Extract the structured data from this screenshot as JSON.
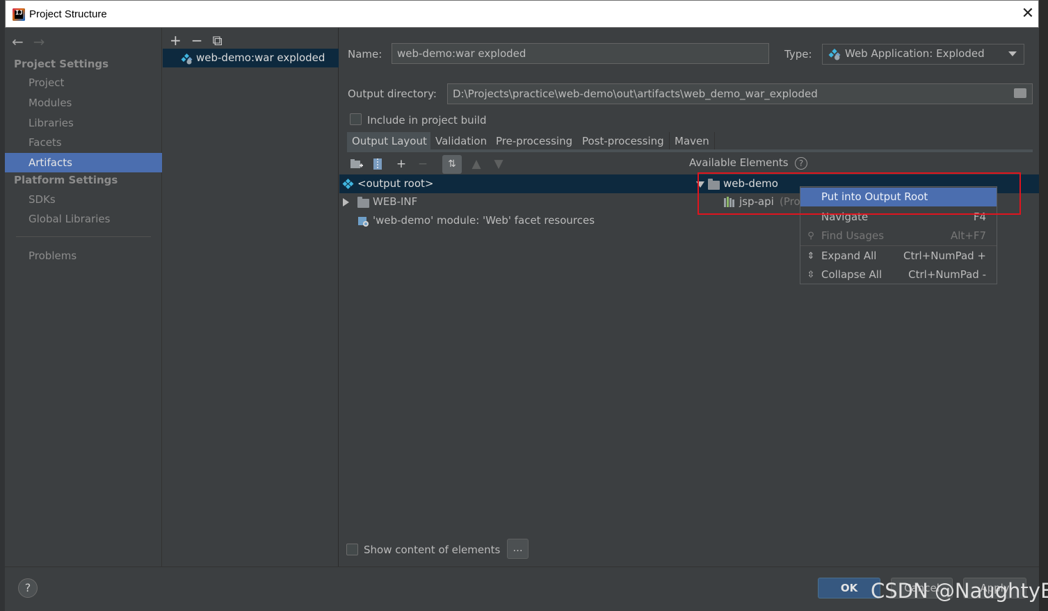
{
  "window": {
    "title": "Project Structure",
    "close_glyph": "✕"
  },
  "nav": {
    "back_glyph": "←",
    "forward_glyph": "→",
    "project_settings_header": "Project Settings",
    "platform_settings_header": "Platform Settings",
    "items": {
      "project": "Project",
      "modules": "Modules",
      "libraries": "Libraries",
      "facets": "Facets",
      "artifacts": "Artifacts",
      "sdks": "SDKs",
      "global_libraries": "Global Libraries",
      "problems": "Problems"
    },
    "selected": "Artifacts"
  },
  "artifacts_list": {
    "toolbar": {
      "add": "+",
      "remove": "−",
      "copy": "⧉"
    },
    "items": [
      "web-demo:war exploded"
    ]
  },
  "form": {
    "name_label": "Name:",
    "name_value": "web-demo:war exploded",
    "type_label": "Type:",
    "type_value": "Web Application: Exploded",
    "output_dir_label": "Output directory:",
    "output_dir_value": "D:\\Projects\\practice\\web-demo\\out\\artifacts\\web_demo_war_exploded",
    "include_build_label": "Include in project build",
    "include_build_checked": false
  },
  "tabs": [
    "Output Layout",
    "Validation",
    "Pre-processing",
    "Post-processing",
    "Maven"
  ],
  "active_tab": "Output Layout",
  "layout_tree": {
    "root": "<output root>",
    "children": [
      "WEB-INF",
      "'web-demo' module: 'Web' facet resources"
    ]
  },
  "available": {
    "header": "Available Elements",
    "help": "?",
    "root": "web-demo",
    "child": "jsp-api",
    "child_suffix": "(Proj"
  },
  "context_menu": {
    "items": [
      {
        "label": "Put into Output Root",
        "shortcut": "",
        "highlighted": true
      },
      {
        "label": "Navigate",
        "shortcut": "F4"
      },
      {
        "label": "Find Usages",
        "shortcut": "Alt+F7",
        "disabled": true
      },
      {
        "label": "Expand All",
        "shortcut": "Ctrl+NumPad +"
      },
      {
        "label": "Collapse All",
        "shortcut": "Ctrl+NumPad -"
      }
    ]
  },
  "show_content_label": "Show content of elements",
  "dots_label": "...",
  "buttons": {
    "help": "?",
    "ok": "OK",
    "cancel": "Cancel",
    "apply": "Apply"
  },
  "watermark": "CSDN @NaughtyBo",
  "colors": {
    "selection": "#4b6eaf",
    "tree_selection": "#0d293e",
    "highlight_box": "#e0141e",
    "ok_button": "#365880"
  }
}
